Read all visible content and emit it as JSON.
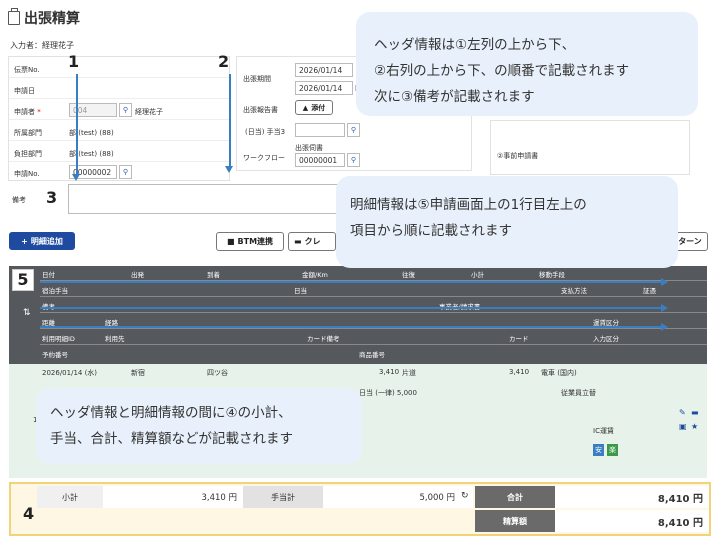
{
  "page": {
    "title": "出張精算",
    "entrant": "入力者：経理花子"
  },
  "left_fields": {
    "slip_no": "伝票No.",
    "apply_date": "申請日",
    "applicant": "申請者",
    "applicant_required": "*",
    "applicant_code": "004",
    "applicant_name": "経理花子",
    "dept": "所属部門",
    "dept_value": "部 (test) (88)",
    "burden": "負担部門",
    "burden_value": "部 (test) (88)",
    "apply_no": "申請No.",
    "apply_no_value": "00000002",
    "remarks": "備考"
  },
  "right_fields": {
    "period": "出張期間",
    "period_from": "2026/01/14",
    "period_to": "2026/01/14",
    "report": "出張報告書",
    "attach": "添付",
    "allowance": "(日当) 手当3",
    "workflow": "ワークフロー",
    "trip_form": "出張伺書",
    "trip_form_value": "00000001",
    "prior_app": "②事前申請書"
  },
  "badges": {
    "b1": "1",
    "b2": "2",
    "b3": "3",
    "b4": "4",
    "b5": "5"
  },
  "callouts": {
    "c1_line1": "ヘッダ情報は①左列の上から下、",
    "c1_line2": "②右列の上から下、の順番で記載されます",
    "c1_line3": "次に③備考が記載されます",
    "c2_line1": "明細情報は⑤申請画面上の1行目左上の",
    "c2_line2": "項目から順に記載されます",
    "c3_line1": "ヘッダ情報と明細情報の間に④の小計、",
    "c3_line2": "手当、合計、精算額などが記載されます"
  },
  "toolbar": {
    "add_detail": "明細追加",
    "btm": "BTM連携",
    "clear": "クレ",
    "pattern": "ターン"
  },
  "table_header": {
    "row1": [
      "日付",
      "出発",
      "到着",
      "金額/Km",
      "往復",
      "小計",
      "移動手段"
    ],
    "row2": [
      "宿泊手当",
      "日当",
      "支払方法",
      "証憑"
    ],
    "row3": [
      "備考",
      "事業者/請求書"
    ],
    "row4": [
      "距離",
      "経路",
      "運賃区分"
    ],
    "row5": [
      "利用明細ID",
      "利用先",
      "カード備考",
      "カード",
      "入力区分"
    ],
    "row6": [
      "予約番号",
      "商品番号"
    ]
  },
  "detail": {
    "date": "2026/01/14 (水)",
    "from": "新宿",
    "to": "四ツ谷",
    "amount": "3,410",
    "trip": "片道",
    "subtotal": "3,410",
    "means": "電車 (国内)",
    "allowance": "日当 (一律) 5,000",
    "payment": "従業員立替",
    "row_no": "1",
    "ic_fare": "IC運賃",
    "tag_a": "安",
    "tag_b": "楽"
  },
  "summary": {
    "subtotal_label": "小計",
    "subtotal_value": "3,410 円",
    "allowance_label": "手当計",
    "allowance_value": "5,000 円",
    "total_label": "合計",
    "total_value": "8,410 円",
    "settle_label": "精算額",
    "settle_value": "8,410 円"
  },
  "colors": {
    "accent": "#1e4aa0",
    "callout": "#e8f0fb",
    "arrow": "#3a7ec2",
    "detail_row": "#e7f3ea",
    "summary_border": "#f2d27a"
  },
  "icons": [
    "document-icon",
    "search-icon",
    "attach-icon",
    "calendar-icon",
    "plus-icon",
    "sort-icon",
    "edit-icon",
    "delete-icon",
    "copy-icon",
    "star-icon",
    "refresh-icon"
  ]
}
